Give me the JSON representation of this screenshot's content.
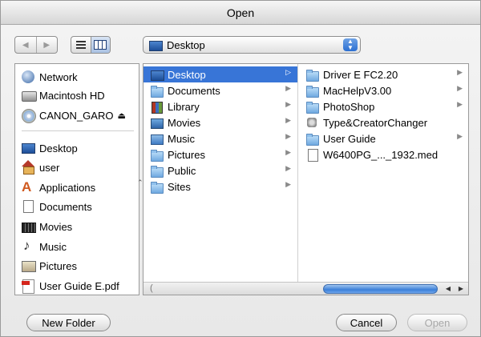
{
  "window": {
    "title": "Open"
  },
  "toolbar": {
    "back_glyph": "◀",
    "forward_glyph": "▶",
    "location": "Desktop",
    "popup_up": "▲",
    "popup_down": "▼"
  },
  "sidebar": {
    "devices": [
      {
        "label": "Network",
        "icon": "network-globe-icon"
      },
      {
        "label": "Macintosh HD",
        "icon": "hard-drive-icon"
      },
      {
        "label": "CANON_GARO",
        "icon": "cd-icon",
        "eject": "⏏"
      }
    ],
    "places": [
      {
        "label": "Desktop",
        "icon": "desktop-icon"
      },
      {
        "label": "user",
        "icon": "home-icon"
      },
      {
        "label": "Applications",
        "icon": "applications-icon"
      },
      {
        "label": "Documents",
        "icon": "document-icon"
      },
      {
        "label": "Movies",
        "icon": "film-icon"
      },
      {
        "label": "Music",
        "icon": "music-note-icon"
      },
      {
        "label": "Pictures",
        "icon": "pictures-icon"
      },
      {
        "label": "User Guide E.pdf",
        "icon": "pdf-icon"
      }
    ]
  },
  "browser": {
    "column1": [
      {
        "label": "Desktop",
        "selected": true,
        "arrow": "▷"
      },
      {
        "label": "Documents",
        "arrow": "▶"
      },
      {
        "label": "Library",
        "arrow": "▶"
      },
      {
        "label": "Movies",
        "arrow": "▶"
      },
      {
        "label": "Music",
        "arrow": "▶"
      },
      {
        "label": "Pictures",
        "arrow": "▶"
      },
      {
        "label": "Public",
        "arrow": "▶"
      },
      {
        "label": "Sites",
        "arrow": "▶"
      }
    ],
    "column2": [
      {
        "label": "Driver E FC2.20",
        "arrow": "▶"
      },
      {
        "label": "MacHelpV3.00",
        "arrow": "▶"
      },
      {
        "label": "PhotoShop",
        "arrow": "▶"
      },
      {
        "label": "Type&CreatorChanger",
        "arrow": ""
      },
      {
        "label": "User Guide",
        "arrow": "▶"
      },
      {
        "label": "W6400PG_..._1932.med",
        "arrow": ""
      }
    ]
  },
  "buttons": {
    "new_folder": "New Folder",
    "cancel": "Cancel",
    "open": "Open"
  }
}
